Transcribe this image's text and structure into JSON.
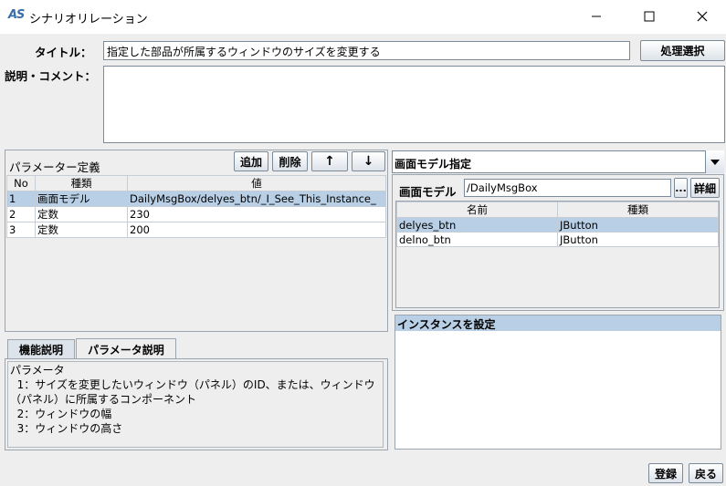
{
  "window": {
    "title": "シナリオリレーション",
    "app_icon_text": "AS",
    "minimize_icon": "minimize-icon",
    "maximize_icon": "maximize-icon",
    "close_icon": "close-icon"
  },
  "form": {
    "title_label": "タイトル：",
    "title_value": "指定した部品が所属するウィンドウのサイズを変更する",
    "process_select_button": "処理選択",
    "comment_label": "説明・コメント：",
    "comment_value": ""
  },
  "params": {
    "header": "パラメーター定義",
    "add_button": "追加",
    "delete_button": "削除",
    "up_button": "↑",
    "down_button": "↓",
    "columns": [
      "No",
      "種類",
      "値"
    ],
    "rows": [
      {
        "no": "1",
        "kind": "画面モデル",
        "value": "DailyMsgBox/delyes_btn/_I_See_This_Instance_",
        "selected": true
      },
      {
        "no": "2",
        "kind": "定数",
        "value": "230",
        "selected": false
      },
      {
        "no": "3",
        "kind": "定数",
        "value": "200",
        "selected": false
      }
    ]
  },
  "tabs": {
    "items": [
      "機能説明",
      "パラメータ説明"
    ],
    "active_index": 1,
    "content_lines": [
      "パラメータ",
      "  1：サイズを変更したいウィンドウ（パネル）のID、または、ウィンドウ",
      "（パネル）に所属するコンポーネント",
      "  2：ウィンドウの幅",
      "  3：ウィンドウの高さ"
    ]
  },
  "screen_model": {
    "dropdown_value": "画面モデル指定",
    "label": "画面モデル",
    "value": "/DailyMsgBox",
    "browse_button": "...",
    "detail_button": "詳細",
    "columns": [
      "名前",
      "種類"
    ],
    "rows": [
      {
        "name": "delyes_btn",
        "kind": "JButton",
        "selected": true
      },
      {
        "name": "delno_btn",
        "kind": "JButton",
        "selected": false
      }
    ]
  },
  "instance": {
    "header": "インスタンスを設定"
  },
  "footer": {
    "register_button": "登録",
    "back_button": "戻る"
  },
  "colors": {
    "selection": "#b8cfe5",
    "panel_bg": "#eeeeee",
    "border": "#7a8a99"
  }
}
